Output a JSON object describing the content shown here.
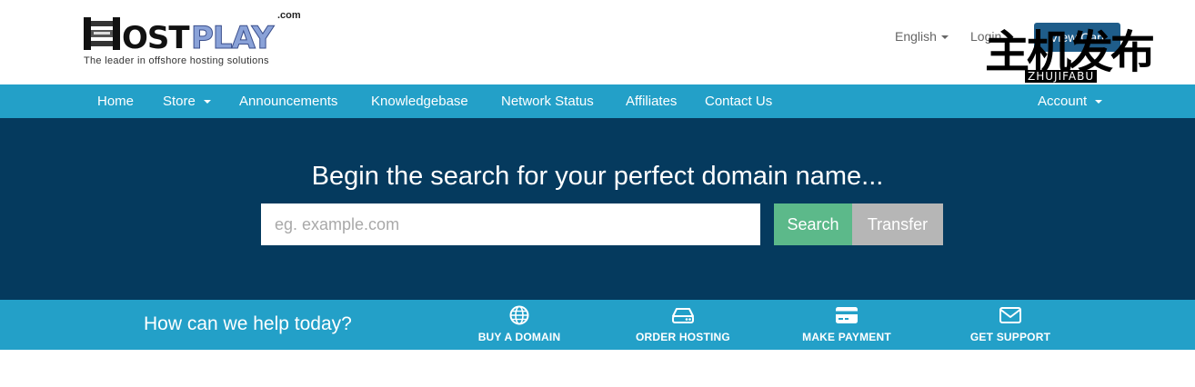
{
  "header": {
    "logo_text": "OSTPLAY",
    "logo_com": ".com",
    "tagline": "The leader in offshore hosting solutions",
    "language": "English",
    "login": "Login",
    "cart_label": "View Cart"
  },
  "watermark": {
    "chinese": "主机发布",
    "latin": "ZHUJIFABU"
  },
  "nav": {
    "items": [
      {
        "label": "Home"
      },
      {
        "label": "Store"
      },
      {
        "label": "Announcements"
      },
      {
        "label": "Knowledgebase"
      },
      {
        "label": "Network Status"
      },
      {
        "label": "Affiliates"
      },
      {
        "label": "Contact Us"
      }
    ],
    "account": "Account"
  },
  "hero": {
    "title": "Begin the search for your perfect domain name...",
    "search_placeholder": "eg. example.com",
    "search_button": "Search",
    "transfer_button": "Transfer"
  },
  "help": {
    "title": "How can we help today?",
    "actions": [
      {
        "label": "BUY A DOMAIN",
        "icon": "globe-icon"
      },
      {
        "label": "ORDER HOSTING",
        "icon": "hard-drive-icon"
      },
      {
        "label": "MAKE PAYMENT",
        "icon": "credit-card-icon"
      },
      {
        "label": "GET SUPPORT",
        "icon": "envelope-icon"
      }
    ]
  },
  "colors": {
    "nav_bg": "#23a0c8",
    "hero_bg": "#053a5e",
    "search_green": "#5cb98a",
    "transfer_gray": "#b6b6b6"
  }
}
